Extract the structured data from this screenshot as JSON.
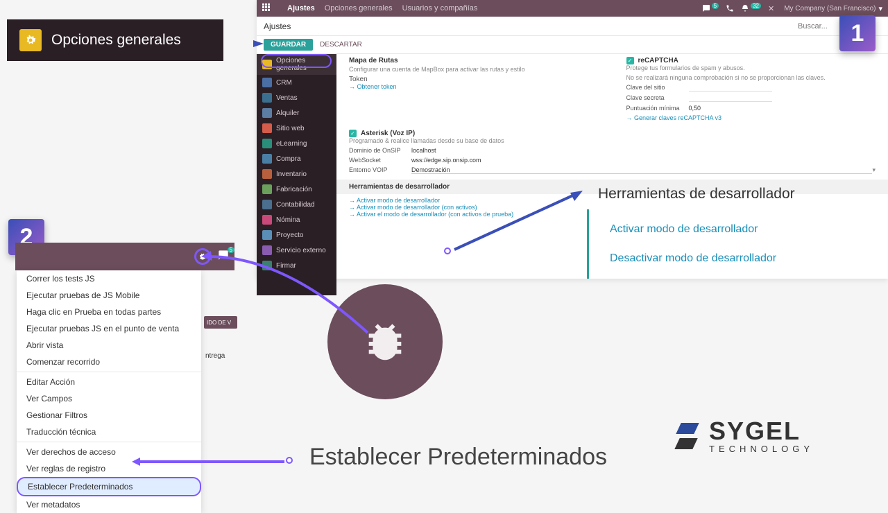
{
  "steps": {
    "one": "1",
    "two": "2"
  },
  "callout_opciones": {
    "title": "Opciones generales"
  },
  "topbar": {
    "app": "Ajustes",
    "menu1": "Opciones generales",
    "menu2": "Usuarios y compañías",
    "company": "My Company (San Francisco)",
    "chat_badge": "5",
    "activity_badge": "32",
    "close": "✕"
  },
  "subbar": {
    "title": "Ajustes",
    "search": "Buscar..."
  },
  "buttons": {
    "save": "GUARDAR",
    "discard": "DESCARTAR"
  },
  "sidebar": {
    "items": [
      {
        "label": "Opciones generales",
        "color": "#e8b923"
      },
      {
        "label": "CRM",
        "color": "#4a6fa5"
      },
      {
        "label": "Ventas",
        "color": "#3a6f8f"
      },
      {
        "label": "Alquiler",
        "color": "#5c7ea3"
      },
      {
        "label": "Sitio web",
        "color": "#d35c4a"
      },
      {
        "label": "eLearning",
        "color": "#2a8f7a"
      },
      {
        "label": "Compra",
        "color": "#4a7fa5"
      },
      {
        "label": "Inventario",
        "color": "#b8603d"
      },
      {
        "label": "Fabricación",
        "color": "#6a9f5c"
      },
      {
        "label": "Contabilidad",
        "color": "#4a6f8f"
      },
      {
        "label": "Nómina",
        "color": "#c94a7a"
      },
      {
        "label": "Proyecto",
        "color": "#5a8fb8"
      },
      {
        "label": "Servicio externo",
        "color": "#8a5caf"
      },
      {
        "label": "Firmar",
        "color": "#3a7f6f"
      }
    ]
  },
  "content": {
    "mapa": {
      "title": "Mapa de Rutas",
      "desc": "Configurar una cuenta de MapBox para activar las rutas y estilo",
      "token_label": "Token",
      "link": "Obtener token"
    },
    "recaptcha": {
      "title": "reCAPTCHA",
      "desc": "Protege tus formularios de spam y abusos.",
      "desc2": "No se realizará ninguna comprobación si no se proporcionan las claves.",
      "f1": "Clave del sitio",
      "f2": "Clave secreta",
      "f3": "Puntuación mínima",
      "f3v": "0,50",
      "link": "Generar claves reCAPTCHA v3"
    },
    "asterisk": {
      "title": "Asterisk (Voz IP)",
      "desc": "Programado & realice llamadas desde su base de datos",
      "f1": "Dominio de OnSIP",
      "f1v": "localhost",
      "f2": "WebSocket",
      "f2v": "wss://edge.sip.onsip.com",
      "f3": "Entorno VOIP",
      "f3v": "Demostración"
    },
    "dev": {
      "header": "Herramientas de desarrollador",
      "l1": "Activar modo de desarrollador",
      "l2": "Activar modo de desarrollador (con activos)",
      "l3": "Activar el modo de desarrollador (con activos de prueba)"
    }
  },
  "dev_callout": {
    "header": "Herramientas de desarrollador",
    "opt1": "Activar modo de desarrollador",
    "opt2": "Desactivar modo de desarrollador"
  },
  "bugbar": {
    "badge": "5"
  },
  "dev_menu": {
    "items1": [
      "Correr los tests JS",
      "Ejecutar pruebas de JS Mobile",
      "Haga clic en Prueba en todas partes",
      "Ejecutar pruebas JS en el punto de venta",
      "Abrir vista",
      "Comenzar recorrido"
    ],
    "items2": [
      "Editar Acción",
      "Ver Campos",
      "Gestionar Filtros",
      "Traducción técnica"
    ],
    "items3": [
      "Ver derechos de acceso",
      "Ver reglas de registro",
      "Establecer Predeterminados",
      "Ver metadatos"
    ]
  },
  "bg": {
    "pill": "IDO DE V",
    "text": "ntrega"
  },
  "bottom": {
    "label": "Establecer Predeterminados"
  },
  "logo": {
    "main": "SYGEL",
    "sub": "TECHNOLOGY"
  }
}
